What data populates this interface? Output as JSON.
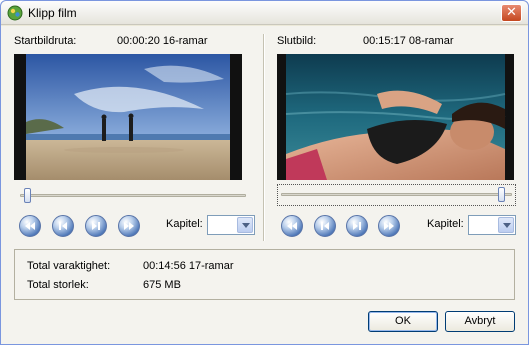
{
  "window": {
    "title": "Klipp film"
  },
  "start": {
    "label": "Startbildruta:",
    "time": "00:00:20 16-ramar",
    "position": 0.02
  },
  "end": {
    "label": "Slutbild:",
    "time": "00:15:17 08-ramar",
    "position": 0.97
  },
  "chapter_label": "Kapitel:",
  "summary": {
    "duration_label": "Total varaktighet:",
    "duration_value": "00:14:56 17-ramar",
    "size_label": "Total storlek:",
    "size_value": "675 MB"
  },
  "buttons": {
    "ok": "OK",
    "cancel": "Avbryt"
  },
  "icons": {
    "app": "film-icon",
    "close": "close-icon",
    "nav": [
      "rewind-icon",
      "previous-frame-icon",
      "next-frame-icon",
      "fast-forward-icon"
    ],
    "dropdown": "chevron-down-icon"
  }
}
